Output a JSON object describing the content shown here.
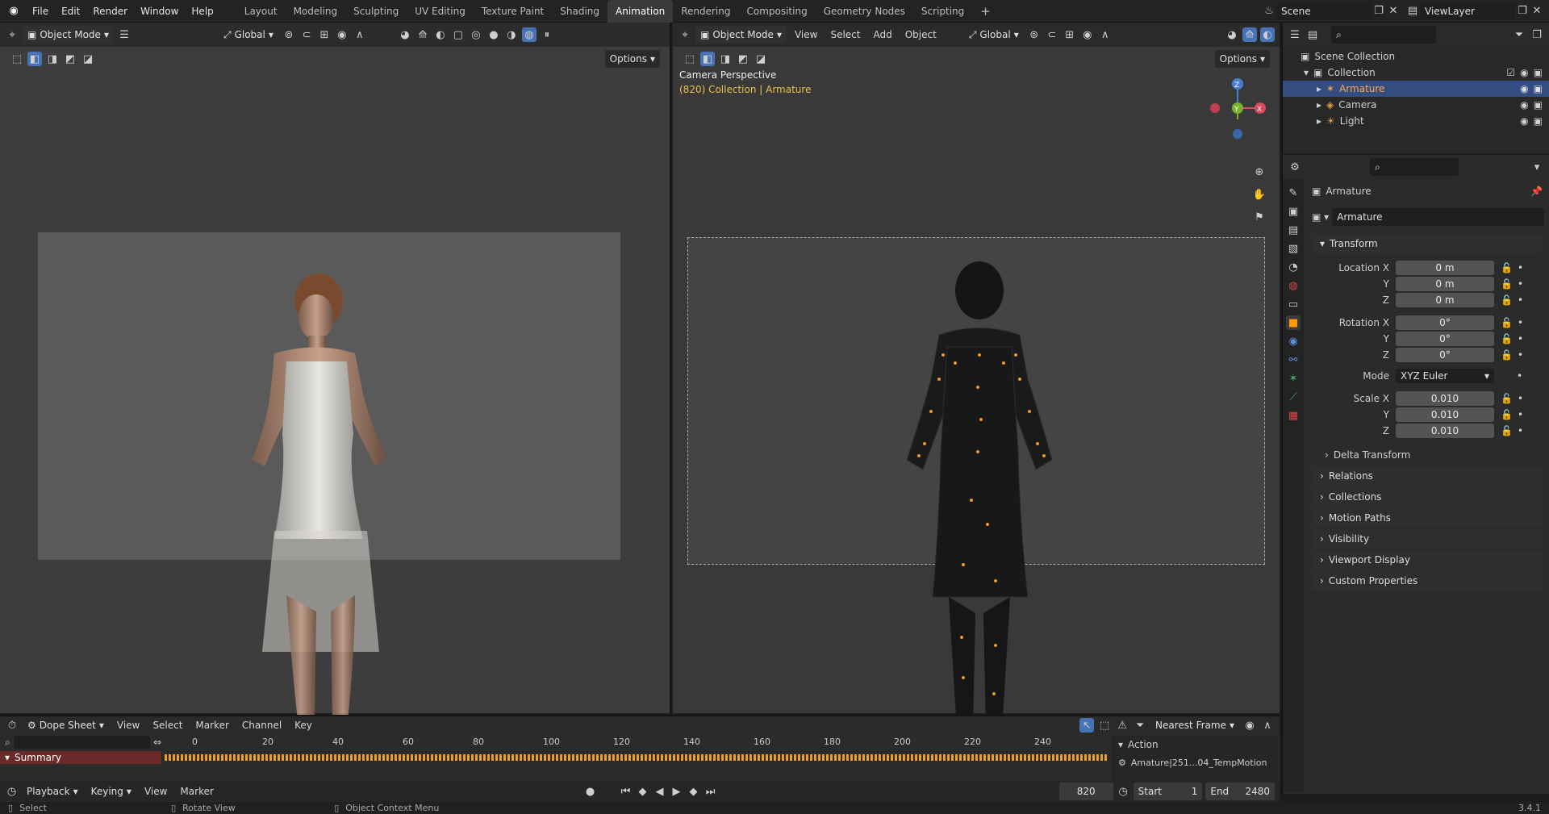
{
  "topbar": {
    "menus": [
      "File",
      "Edit",
      "Render",
      "Window",
      "Help"
    ],
    "workspaces": [
      "Layout",
      "Modeling",
      "Sculpting",
      "UV Editing",
      "Texture Paint",
      "Shading",
      "Animation",
      "Rendering",
      "Compositing",
      "Geometry Nodes",
      "Scripting"
    ],
    "active_workspace": "Animation",
    "add_workspace": "+",
    "scene": "Scene",
    "view_layer": "ViewLayer"
  },
  "left_viewport": {
    "mode": "Object Mode",
    "orientation": "Global",
    "options_label": "Options"
  },
  "right_viewport": {
    "mode": "Object Mode",
    "menus": [
      "View",
      "Select",
      "Add",
      "Object"
    ],
    "orientation": "Global",
    "options_label": "Options",
    "camera_label": "Camera Perspective",
    "collection_label": "(820) Collection | Armature"
  },
  "outliner": {
    "root": "Scene Collection",
    "collection": "Collection",
    "items": [
      "Armature",
      "Camera",
      "Light"
    ]
  },
  "properties": {
    "object_name": "Armature",
    "data_name": "Armature",
    "transform_label": "Transform",
    "location": {
      "label": "Location X",
      "x": "0 m",
      "y": "0 m",
      "z": "0 m"
    },
    "rotation": {
      "label": "Rotation X",
      "x": "0°",
      "y": "0°",
      "z": "0°"
    },
    "mode_label": "Mode",
    "mode_value": "XYZ Euler",
    "scale": {
      "label": "Scale X",
      "x": "0.010",
      "y": "0.010",
      "z": "0.010"
    },
    "axis_y": "Y",
    "axis_z": "Z",
    "delta_transform": "Delta Transform",
    "panels": [
      "Relations",
      "Collections",
      "Motion Paths",
      "Visibility",
      "Viewport Display",
      "Custom Properties"
    ]
  },
  "dopesheet": {
    "editor": "Dope Sheet",
    "menus": [
      "View",
      "Select",
      "Marker",
      "Channel",
      "Key"
    ],
    "snap_mode": "Nearest Frame",
    "ruler": [
      "0",
      "20",
      "40",
      "60",
      "80",
      "100",
      "120",
      "140",
      "160",
      "180",
      "200",
      "220",
      "240"
    ],
    "summary": "Summary",
    "action_label": "Action",
    "action_name": "Amature|251...04_TempMotion"
  },
  "timeline": {
    "menus": [
      "Playback",
      "Keying",
      "View",
      "Marker"
    ],
    "current_frame": "820",
    "start_label": "Start",
    "start": "1",
    "end_label": "End",
    "end": "2480"
  },
  "statusbar": {
    "select": "Select",
    "rotate": "Rotate View",
    "context": "Object Context Menu",
    "version": "3.4.1"
  }
}
